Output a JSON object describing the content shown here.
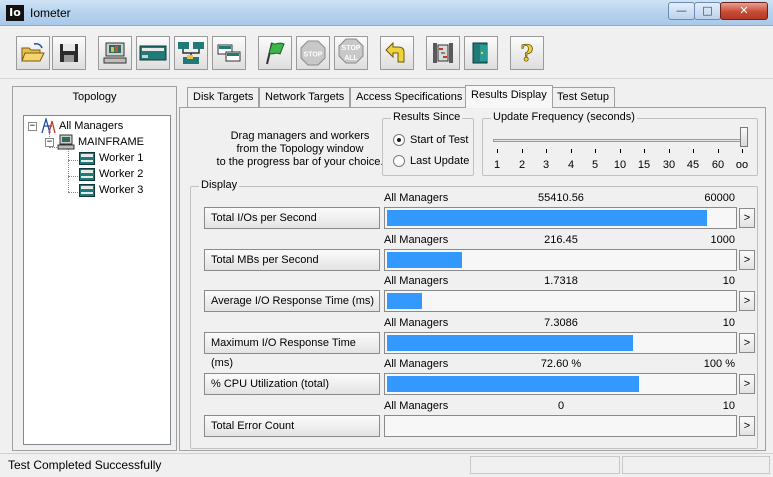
{
  "window": {
    "title": "Iometer",
    "icon_text": "Io",
    "controls": {
      "minimize": "—",
      "maximize": "□",
      "close": "✕"
    }
  },
  "toolbar": {
    "buttons": [
      {
        "name": "open-config-button",
        "icon": "open-folder-icon"
      },
      {
        "name": "save-config-button",
        "icon": "floppy-disk-icon"
      },
      {
        "name": "show-results-button",
        "icon": "computer-icon"
      },
      {
        "name": "new-disk-worker-button",
        "icon": "disk-worker-icon"
      },
      {
        "name": "new-network-worker-button",
        "icon": "network-worker-icon"
      },
      {
        "name": "duplicate-worker-button",
        "icon": "duplicate-worker-icon"
      },
      {
        "name": "start-tests-button",
        "icon": "green-flag-icon"
      },
      {
        "name": "stop-test-button",
        "icon": "stop-sign-icon",
        "label": "STOP"
      },
      {
        "name": "stop-all-button",
        "icon": "stop-all-icon",
        "label_top": "STOP",
        "label_bottom": "ALL"
      },
      {
        "name": "reset-workers-button",
        "icon": "reset-arrow-icon"
      },
      {
        "name": "exit-button",
        "icon": "exit-door-icon"
      },
      {
        "name": "disconnect-button",
        "icon": "disconnect-icon"
      },
      {
        "name": "about-button",
        "icon": "question-mark-icon",
        "label": "?"
      }
    ]
  },
  "topology": {
    "title": "Topology",
    "root": {
      "label": "All Managers",
      "expander": "−"
    },
    "manager": {
      "label": "MAINFRAME",
      "expander": "−"
    },
    "workers": [
      "Worker 1",
      "Worker 2",
      "Worker 3"
    ]
  },
  "tabs": [
    {
      "label": "Disk Targets",
      "active": false
    },
    {
      "label": "Network Targets",
      "active": false
    },
    {
      "label": "Access Specifications",
      "active": false
    },
    {
      "label": "Results Display",
      "active": true
    },
    {
      "label": "Test Setup",
      "active": false
    }
  ],
  "results_display": {
    "drag_text": [
      "Drag managers and workers",
      "from the Topology window",
      "to the progress bar of your choice."
    ],
    "results_since": {
      "title": "Results Since",
      "options": [
        {
          "label": "Start of Test",
          "selected": true
        },
        {
          "label": "Last Update",
          "selected": false
        }
      ]
    },
    "update_frequency": {
      "title": "Update Frequency (seconds)",
      "ticks": [
        "1",
        "2",
        "3",
        "4",
        "5",
        "10",
        "15",
        "30",
        "45",
        "60",
        "oo"
      ],
      "selected": "oo"
    },
    "display_group_title": "Display",
    "arrow_label": ">",
    "rows": [
      {
        "metric": "Total I/Os per Second",
        "source": "All Managers",
        "value": "55410.56",
        "max": "60000",
        "fraction": 0.9235
      },
      {
        "metric": "Total MBs per Second",
        "source": "All Managers",
        "value": "216.45",
        "max": "1000",
        "fraction": 0.21645
      },
      {
        "metric": "Average I/O Response Time (ms)",
        "source": "All Managers",
        "value": "1.7318",
        "max": "10",
        "fraction": 0.1
      },
      {
        "metric": "Maximum I/O Response Time (ms)",
        "source": "All Managers",
        "value": "7.3086",
        "max": "10",
        "fraction": 0.7086
      },
      {
        "metric": "% CPU Utilization (total)",
        "source": "All Managers",
        "value": "72.60 %",
        "max": "100 %",
        "fraction": 0.726
      },
      {
        "metric": "Total Error Count",
        "source": "All Managers",
        "value": "0",
        "max": "10",
        "fraction": 0
      }
    ]
  },
  "statusbar": {
    "text": "Test Completed Successfully"
  },
  "colors": {
    "bar_fill": "#3399ff",
    "titlebar": "#b7d2ee",
    "close_button": "#c74b36"
  }
}
